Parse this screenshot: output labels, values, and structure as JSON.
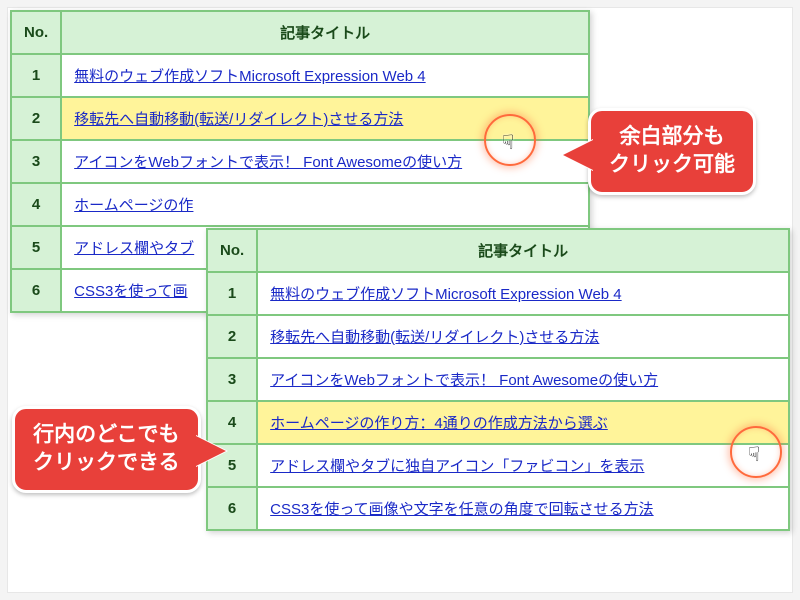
{
  "headers": {
    "no": "No.",
    "title": "記事タイトル"
  },
  "rows": [
    {
      "no": "1",
      "title": "無料のウェブ作成ソフトMicrosoft Expression Web 4"
    },
    {
      "no": "2",
      "title": "移転先へ自動移動(転送/リダイレクト)させる方法"
    },
    {
      "no": "3",
      "title": "アイコンをWebフォントで表示！ Font Awesomeの使い方"
    },
    {
      "no": "4",
      "title": "ホームページの作り方：4通りの作成方法から選ぶ"
    },
    {
      "no": "5",
      "title": "アドレス欄やタブに独自アイコン「ファビコン」を表示"
    },
    {
      "no": "6",
      "title": "CSS3を使って画像や文字を任意の角度で回転させる方法"
    }
  ],
  "rows_back_truncated": [
    {
      "no": "4",
      "title": "ホームページの作"
    },
    {
      "no": "5",
      "title": "アドレス欄やタブ"
    },
    {
      "no": "6",
      "title": "CSS3を使って画"
    }
  ],
  "bubbles": {
    "top": "余白部分も\nクリック可能",
    "bottom": "行内のどこでも\nクリックできる"
  },
  "cursor_glyph": "☟"
}
